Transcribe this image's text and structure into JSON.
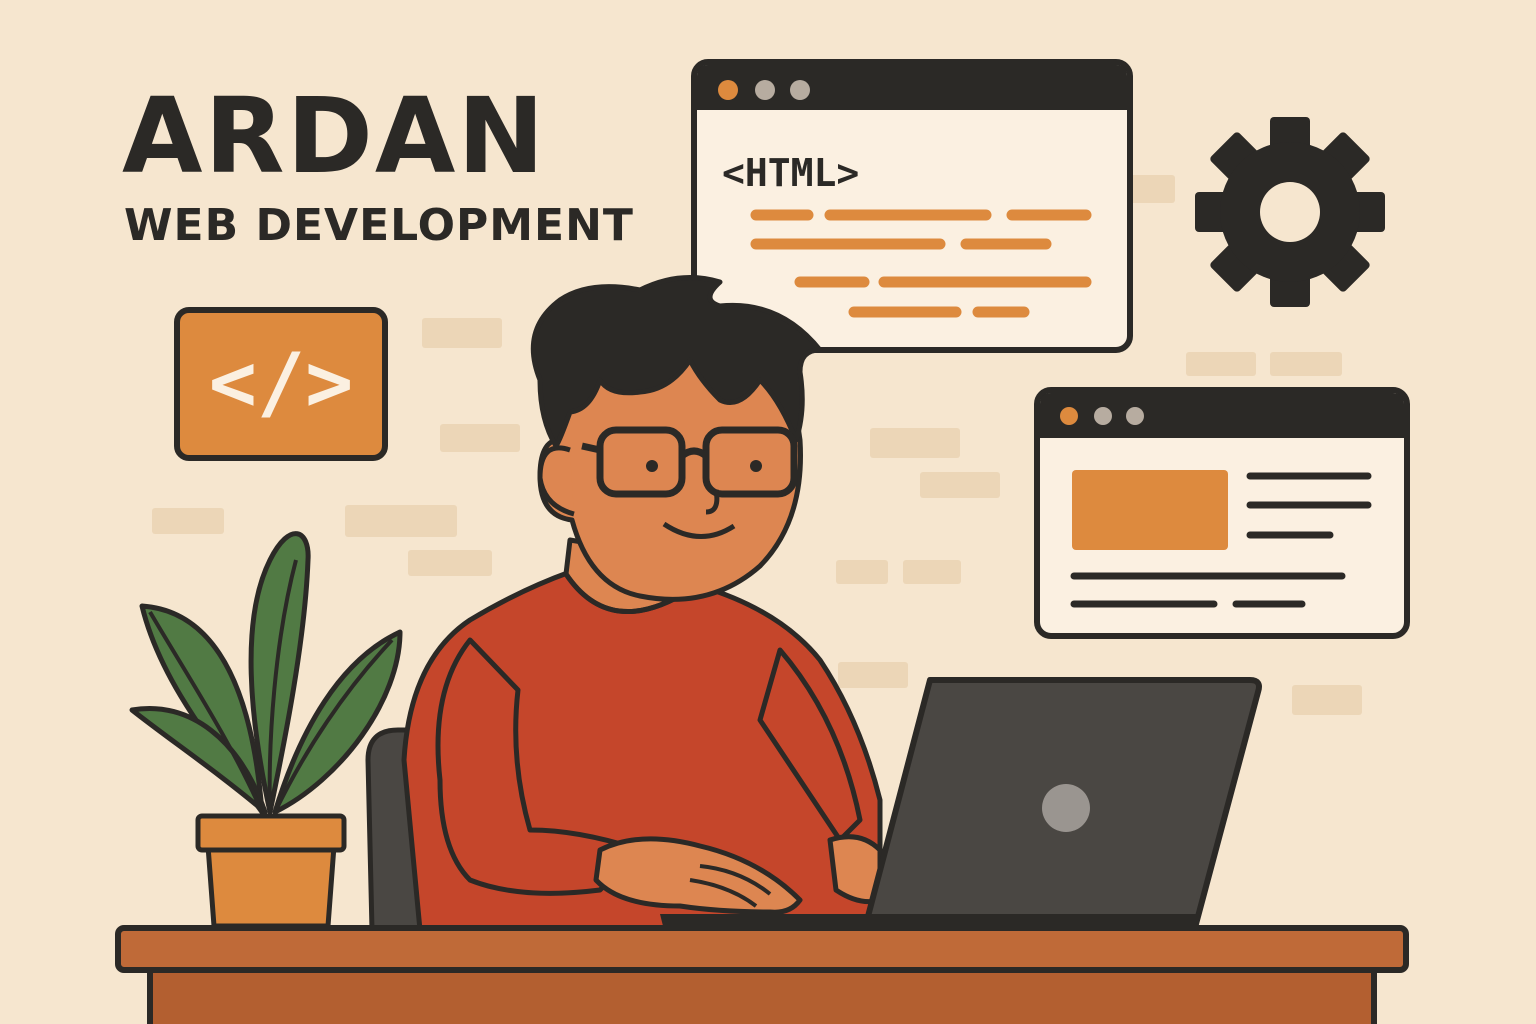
{
  "brand": {
    "title": "ARDAN",
    "subtitle": "WEB DEVELOPMENT"
  },
  "code_window": {
    "tag_text": "<HTML>"
  },
  "code_badge": {
    "text": "</>"
  },
  "colors": {
    "background": "#f6e6cf",
    "ink": "#2b2926",
    "accent_orange": "#dd8a3e",
    "sweater": "#c5462b",
    "skin": "#dd8651",
    "desk": "#bf6a38",
    "plant_green": "#517a44",
    "laptop": "#4a4743",
    "window_paper": "#fbf0e1"
  },
  "icons": [
    "code-icon",
    "gear-icon",
    "browser-window-icon",
    "plant-icon",
    "laptop-icon"
  ]
}
